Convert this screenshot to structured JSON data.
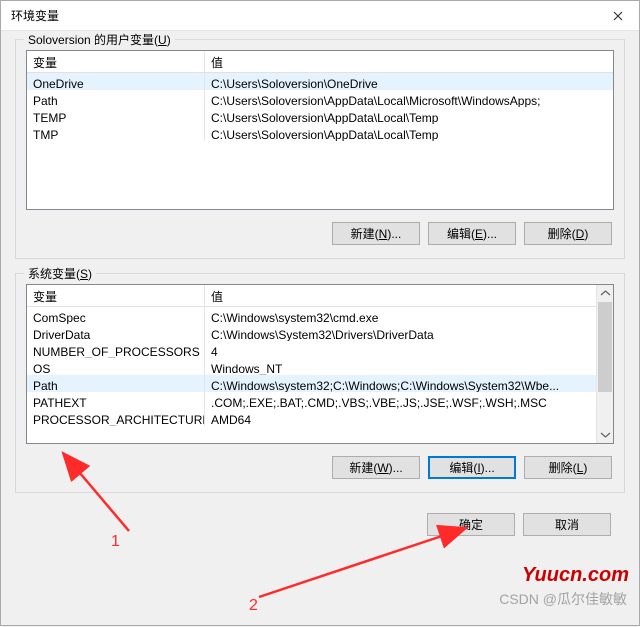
{
  "title": "环境变量",
  "user_section": {
    "label_pre": "Soloversion 的用户变量(",
    "label_hot": "U",
    "label_post": ")",
    "header_name": "变量",
    "header_value": "值",
    "rows": [
      {
        "name": "OneDrive",
        "value": "C:\\Users\\Soloversion\\OneDrive"
      },
      {
        "name": "Path",
        "value": "C:\\Users\\Soloversion\\AppData\\Local\\Microsoft\\WindowsApps;"
      },
      {
        "name": "TEMP",
        "value": "C:\\Users\\Soloversion\\AppData\\Local\\Temp"
      },
      {
        "name": "TMP",
        "value": "C:\\Users\\Soloversion\\AppData\\Local\\Temp"
      }
    ],
    "buttons": {
      "new_pre": "新建(",
      "new_hot": "N",
      "new_post": ")...",
      "edit_pre": "编辑(",
      "edit_hot": "E",
      "edit_post": ")...",
      "del_pre": "删除(",
      "del_hot": "D",
      "del_post": ")"
    }
  },
  "system_section": {
    "label_pre": "系统变量(",
    "label_hot": "S",
    "label_post": ")",
    "header_name": "变量",
    "header_value": "值",
    "rows": [
      {
        "name": "ComSpec",
        "value": "C:\\Windows\\system32\\cmd.exe"
      },
      {
        "name": "DriverData",
        "value": "C:\\Windows\\System32\\Drivers\\DriverData"
      },
      {
        "name": "NUMBER_OF_PROCESSORS",
        "value": "4"
      },
      {
        "name": "OS",
        "value": "Windows_NT"
      },
      {
        "name": "Path",
        "value": "C:\\Windows\\system32;C:\\Windows;C:\\Windows\\System32\\Wbe..."
      },
      {
        "name": "PATHEXT",
        "value": ".COM;.EXE;.BAT;.CMD;.VBS;.VBE;.JS;.JSE;.WSF;.WSH;.MSC"
      },
      {
        "name": "PROCESSOR_ARCHITECTURE",
        "value": "AMD64"
      }
    ],
    "buttons": {
      "new_pre": "新建(",
      "new_hot": "W",
      "new_post": ")...",
      "edit_pre": "编辑(",
      "edit_hot": "I",
      "edit_post": ")...",
      "del_pre": "删除(",
      "del_hot": "L",
      "del_post": ")"
    }
  },
  "dialog_buttons": {
    "ok": "确定",
    "cancel": "取消"
  },
  "annotations": {
    "num1": "1",
    "num2": "2"
  },
  "watermarks": {
    "site": "Yuucn.com",
    "csdn": "CSDN @瓜尔佳敏敏"
  }
}
